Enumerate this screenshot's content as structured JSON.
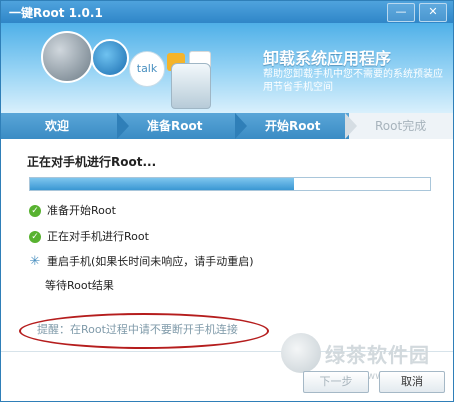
{
  "window": {
    "title": "一键Root 1.0.1",
    "min_label": "—",
    "close_label": "✕"
  },
  "banner": {
    "title": "卸载系统应用程序",
    "subtitle": "帮助您卸载手机中您不需要的系统预装应用节省手机空间",
    "talk_label": "talk"
  },
  "steps": [
    {
      "label": "欢迎",
      "state": "done"
    },
    {
      "label": "准备Root",
      "state": "done"
    },
    {
      "label": "开始Root",
      "state": "active"
    },
    {
      "label": "Root完成",
      "state": "pending"
    }
  ],
  "status": {
    "text": "正在对手机进行Root..."
  },
  "progress": {
    "percent": 66
  },
  "tasks": [
    {
      "text": "准备开始Root",
      "icon": "check-icon"
    },
    {
      "text": "正在对手机进行Root",
      "icon": "check-icon"
    },
    {
      "text": "重启手机(如果长时间未响应，请手动重启)",
      "icon": "spinner-icon"
    },
    {
      "text": "等待Root结果",
      "icon": ""
    }
  ],
  "reminder": {
    "text": "提醒：在Root过程中请不要断开手机连接"
  },
  "buttons": {
    "next": "下一步",
    "cancel": "取消"
  },
  "watermark": {
    "text": "绿茶软件园",
    "url": "www.33lc.com"
  },
  "colors": {
    "accent": "#3a8cc4",
    "check": "#58b230",
    "highlight": "#b51d1d"
  }
}
